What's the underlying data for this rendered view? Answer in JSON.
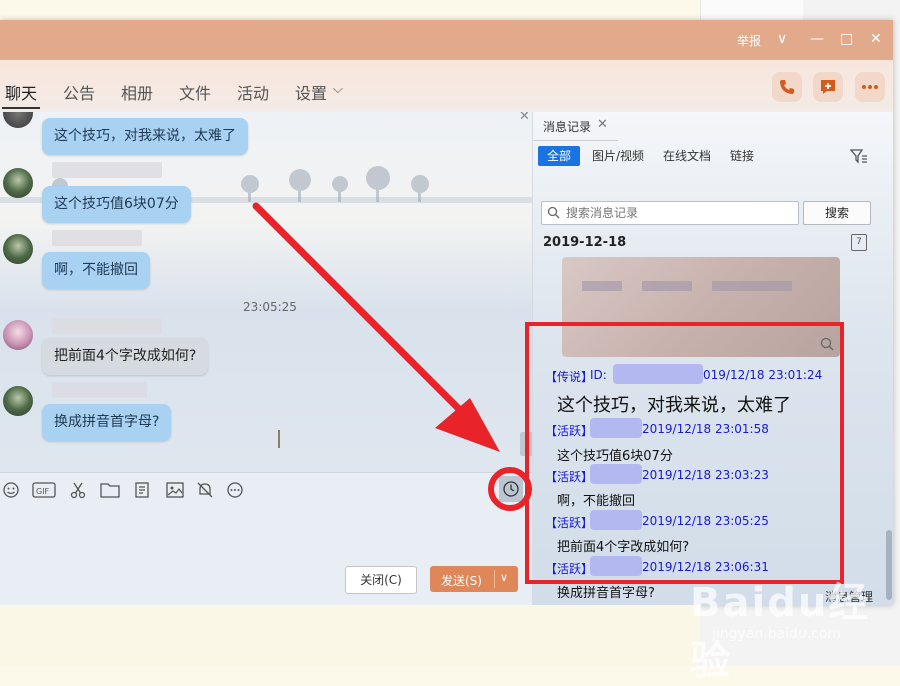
{
  "window": {
    "report_label": "举报",
    "controls": {
      "dropdown": "∨",
      "minimize": "—",
      "maximize": "□",
      "close": "✕"
    }
  },
  "tabs": [
    "聊天",
    "公告",
    "相册",
    "文件",
    "活动",
    "设置"
  ],
  "tab_dropdown": "⌵",
  "chat": {
    "messages": [
      {
        "text": "这个技巧，对我来说，太难了"
      },
      {
        "text": "这个技巧值6块07分"
      },
      {
        "text": "啊，不能撤回"
      },
      {
        "text": "把前面4个字改成如何?"
      },
      {
        "text": "换成拼音首字母?"
      }
    ],
    "timestamp": "23:05:25",
    "close_x": "✕"
  },
  "toolbar_icons": [
    "emoji-icon",
    "gif-icon",
    "scissors-icon",
    "folder-icon",
    "doc-icon",
    "image-icon",
    "bell-icon",
    "more-icon",
    "history-clock-icon"
  ],
  "buttons": {
    "close_label": "关闭(C)",
    "send_label": "发送(S)"
  },
  "panel": {
    "tab_label": "消息记录",
    "tab_close": "✕",
    "filters": [
      "全部",
      "图片/视频",
      "在线文档",
      "链接"
    ],
    "search_placeholder": "搜索消息记录",
    "search_button": "搜索",
    "date": "2019-12-18",
    "calendar_day": "7",
    "manage_label": "消息管理",
    "records": [
      {
        "tag": "【传说】",
        "id_label": "ID:",
        "time": "019/12/18 23:01:24",
        "text": "这个技巧，对我来说，太难了"
      },
      {
        "tag": "【活跃】",
        "time": "2019/12/18 23:01:58",
        "text": "这个技巧值6块07分"
      },
      {
        "tag": "【活跃】",
        "time": "2019/12/18 23:03:23",
        "text": "啊，不能撤回"
      },
      {
        "tag": "【活跃】",
        "time": "2019/12/18 23:05:25",
        "text": "把前面4个字改成如何?"
      },
      {
        "tag": "【活跃】",
        "time": "2019/12/18 23:06:31",
        "text": "换成拼音首字母?"
      }
    ]
  },
  "watermark": {
    "brand": "Baidu经验",
    "url": "jingyan.baidu.com"
  },
  "colors": {
    "accent": "#1b73e0",
    "send": "#e0875a",
    "highlight": "#e8242a",
    "arrow": "#e8242a"
  }
}
